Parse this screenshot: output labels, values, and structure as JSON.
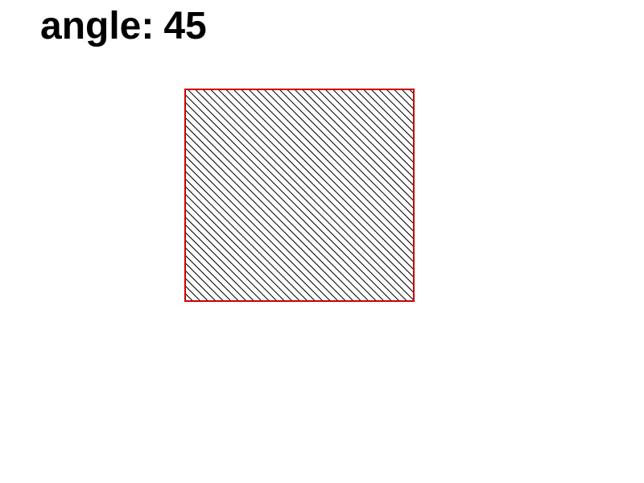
{
  "caption": {
    "label": "angle:",
    "value": "45"
  },
  "hatch": {
    "angle_deg": 45,
    "line_color": "#000000",
    "border_color": "#cc0000",
    "fill_color": "#ffffff"
  }
}
